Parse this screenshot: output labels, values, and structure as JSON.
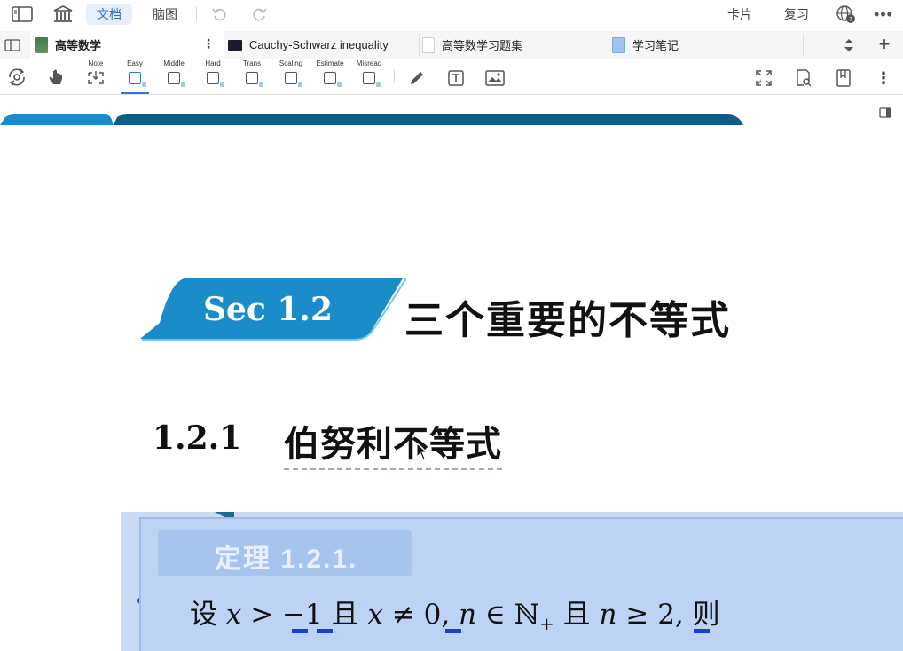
{
  "toolbar": {
    "tabs": [
      {
        "label": "文档",
        "active": true
      },
      {
        "label": "脑图",
        "active": false
      }
    ],
    "right": {
      "cards_label": "卡片",
      "review_label": "复习"
    }
  },
  "doc_tabs": [
    {
      "label": "高等数学",
      "active": true
    },
    {
      "label": "Cauchy-Schwarz inequality",
      "active": false
    },
    {
      "label": "高等数学习题集",
      "active": false
    },
    {
      "label": "学习笔记",
      "active": false
    }
  ],
  "tools": [
    {
      "label": "Note"
    },
    {
      "label": "Easy",
      "active": true
    },
    {
      "label": "Middle"
    },
    {
      "label": "Hard"
    },
    {
      "label": "Trans"
    },
    {
      "label": "Scaling"
    },
    {
      "label": "Estimate"
    },
    {
      "label": "Misread"
    }
  ],
  "document": {
    "section_badge": "Sec 1.2",
    "section_title": "三个重要的不等式",
    "subsection_number": "1.2.1",
    "subsection_title": "伯努利不等式",
    "theorem_label": "定理 1.2.1.",
    "theorem_statement": {
      "prefix": "设 ",
      "var_x": "x",
      "gt": " > ",
      "neg_one": "−1",
      "and1": " 且 ",
      "var_x2": "x",
      "neq": " ≠ ",
      "zero": "0",
      "comma": ", ",
      "var_n": "n",
      "in": " ∈ ",
      "set": "ℕ",
      "sub_plus": "+",
      "and2": " 且 ",
      "var_n2": "n",
      "geq": " ≥ ",
      "two": "2",
      "then": ", 则"
    }
  },
  "colors": {
    "accent": "#2f78d0",
    "banner_blue": "#1a8cc9",
    "banner_dark": "#0d5d86",
    "highlight": "#bcd3f4",
    "underline_mark": "#1a3fd0"
  }
}
